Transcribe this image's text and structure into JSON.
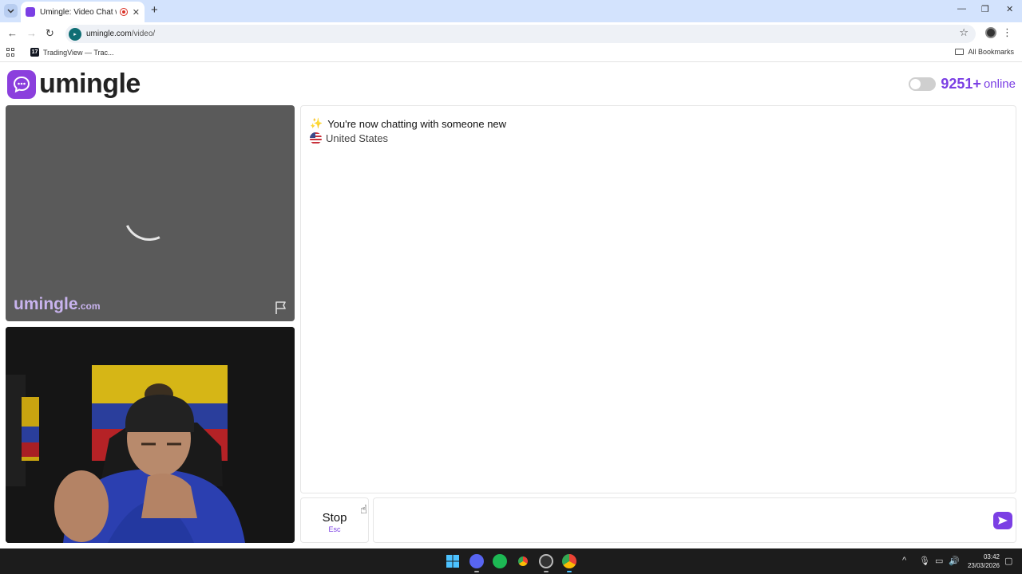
{
  "browser": {
    "tab_title": "Umingle: Video Chat with St",
    "tab_close": "✕",
    "new_tab": "+",
    "url_host": "umingle.com",
    "url_path": "/video/",
    "bookmark_item": "TradingView — Trac...",
    "all_bookmarks": "All Bookmarks",
    "window_minimize": "—",
    "window_restore": "❐",
    "window_close": "✕"
  },
  "header": {
    "logo_text": "umingle",
    "online_count": "9251+",
    "online_label": "online"
  },
  "stranger_video": {
    "watermark_main": "umingle",
    "watermark_domain": ".com"
  },
  "chat": {
    "status_message": "You're now chatting with someone new",
    "country": "United States",
    "message_value": "",
    "message_placeholder": ""
  },
  "controls": {
    "stop_label": "Stop",
    "stop_shortcut": "Esc"
  },
  "taskbar": {
    "time": "03:42",
    "date": "23/03/2026"
  },
  "colors": {
    "brand": "#7b3fe4",
    "logo_bg": "#8b3fdd",
    "tab_bar": "#d3e3fd"
  }
}
